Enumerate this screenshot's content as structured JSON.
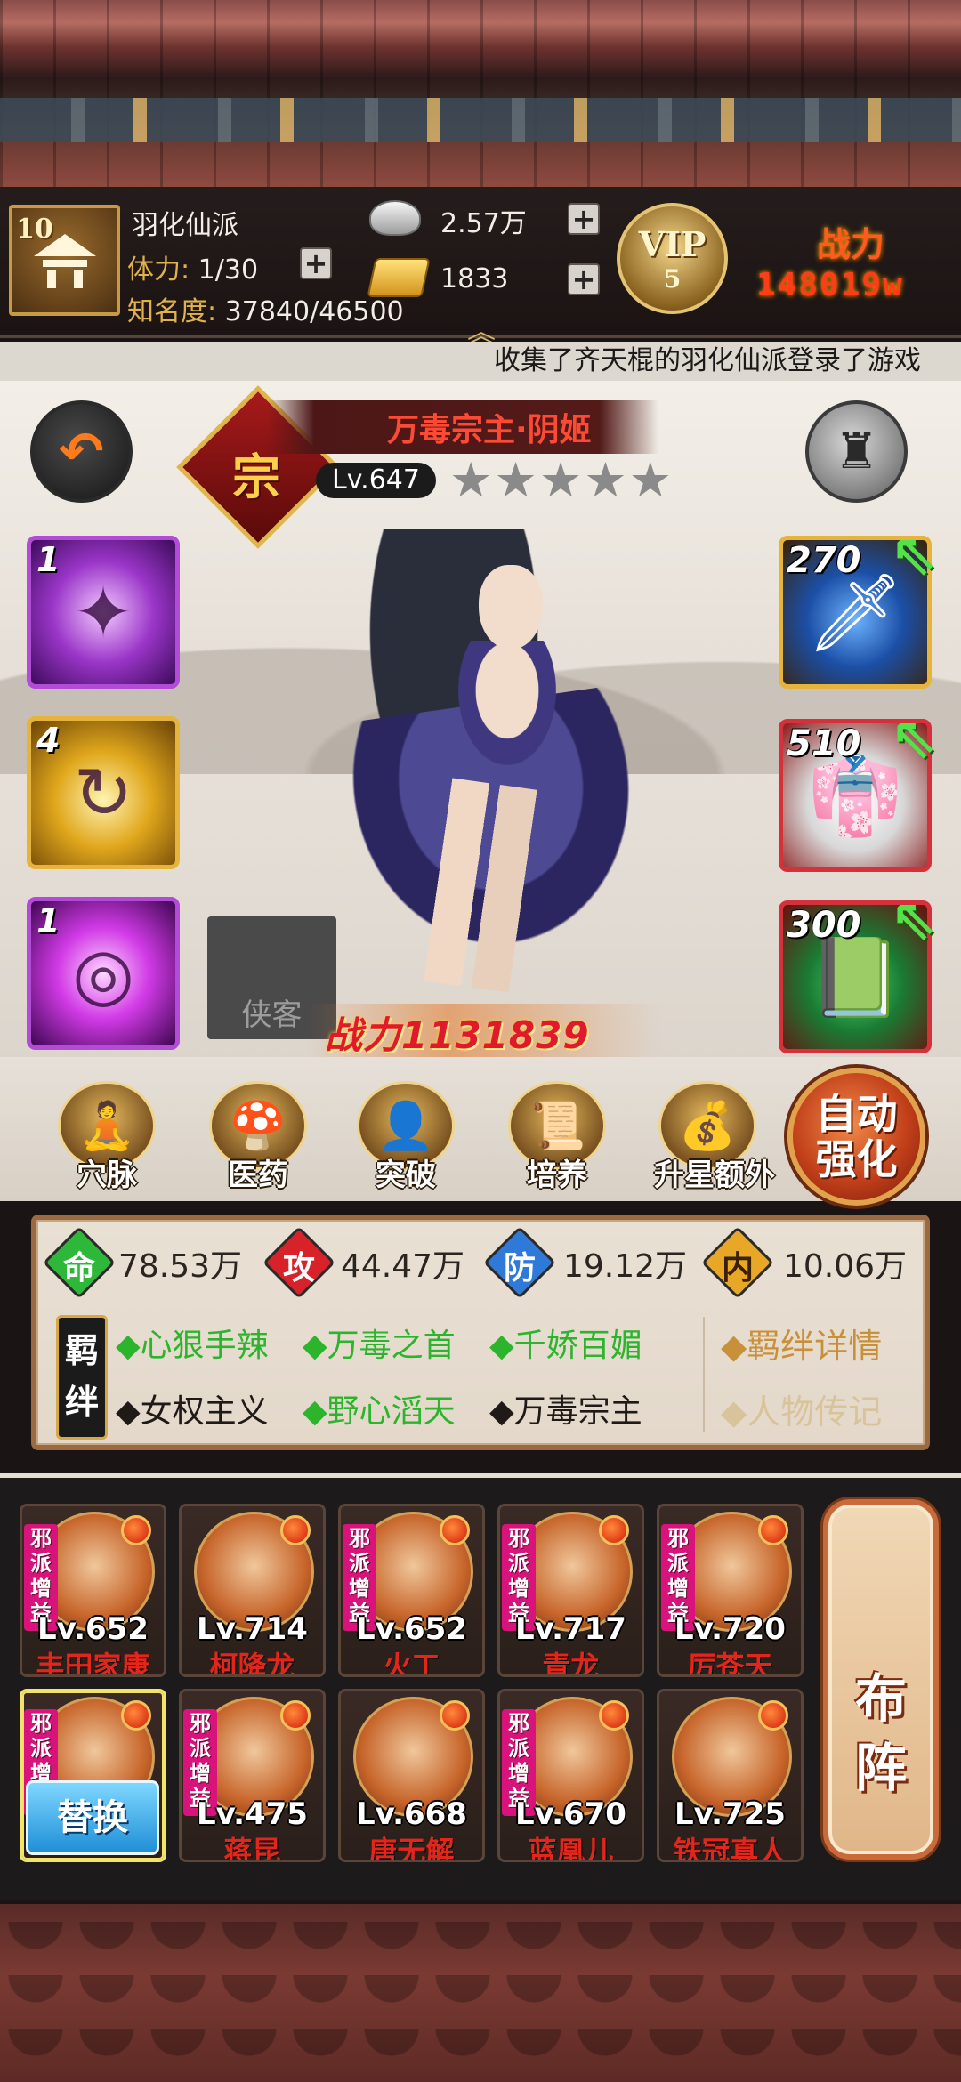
{
  "header": {
    "guild_level": "10",
    "player_name": "羽化仙派",
    "stamina_label": "体力:",
    "stamina_value": "1/30",
    "fame_label": "知名度:",
    "fame_value": "37840/46500",
    "silver": "2.57万",
    "gold": "1833",
    "vip_label": "VIP",
    "vip_level": "5",
    "power_label": "战力",
    "power_value": "148019w",
    "plus": "+"
  },
  "marquee": "收集了齐天棍的羽化仙派登录了游戏",
  "hero": {
    "rank": "宗",
    "name": "万毒宗主·阴姬",
    "level": "Lv.647",
    "stars": "★★★★★",
    "power": "战力1131839",
    "xiake_label": "侠客"
  },
  "skills": [
    "1",
    "4",
    "1"
  ],
  "equipment": [
    "270",
    "510",
    "300"
  ],
  "actions": [
    "穴脉",
    "医药",
    "突破",
    "培养",
    "升星额外"
  ],
  "auto_enhance": [
    "自动",
    "强化"
  ],
  "stats": [
    {
      "char": "命",
      "value": "78.53万",
      "color": "#2eb83a",
      "text_color": "#ffffff"
    },
    {
      "char": "攻",
      "value": "44.47万",
      "color": "#d8222a",
      "text_color": "#ffffff"
    },
    {
      "char": "防",
      "value": "19.12万",
      "color": "#2f7ad8",
      "text_color": "#ffffff"
    },
    {
      "char": "内",
      "value": "10.06万",
      "color": "#e8a726",
      "text_color": "#3a2004"
    }
  ],
  "bond_tag": [
    "羁",
    "绊"
  ],
  "bonds_row1": [
    {
      "text": "◆心狠手辣",
      "style": "green"
    },
    {
      "text": "◆万毒之首",
      "style": "green"
    },
    {
      "text": "◆千娇百媚",
      "style": "green"
    }
  ],
  "bonds_row2": [
    {
      "text": "◆女权主义",
      "style": "black"
    },
    {
      "text": "◆野心滔天",
      "style": "green"
    },
    {
      "text": "◆万毒宗主",
      "style": "black"
    }
  ],
  "bond_links": [
    "◆羁绊详情",
    "◆人物传记"
  ],
  "team": [
    {
      "lv": "Lv.652",
      "name": "丰田家康",
      "evil": "邪派增益"
    },
    {
      "lv": "Lv.714",
      "name": "柯降龙",
      "evil": ""
    },
    {
      "lv": "Lv.652",
      "name": "火工",
      "evil": "邪派增益"
    },
    {
      "lv": "Lv.717",
      "name": "青龙",
      "evil": "邪派增益"
    },
    {
      "lv": "Lv.720",
      "name": "厉苍天",
      "evil": "邪派增益"
    },
    {
      "lv": "",
      "name": "",
      "evil": "邪派增"
    },
    {
      "lv": "Lv.475",
      "name": "蒋昆",
      "evil": "邪派增益"
    },
    {
      "lv": "Lv.668",
      "name": "唐无解",
      "evil": ""
    },
    {
      "lv": "Lv.670",
      "name": "蓝凰儿",
      "evil": "邪派增益"
    },
    {
      "lv": "Lv.725",
      "name": "铁冠真人",
      "evil": ""
    }
  ],
  "replace_label": "替换",
  "formation_label": [
    "布",
    "阵"
  ]
}
